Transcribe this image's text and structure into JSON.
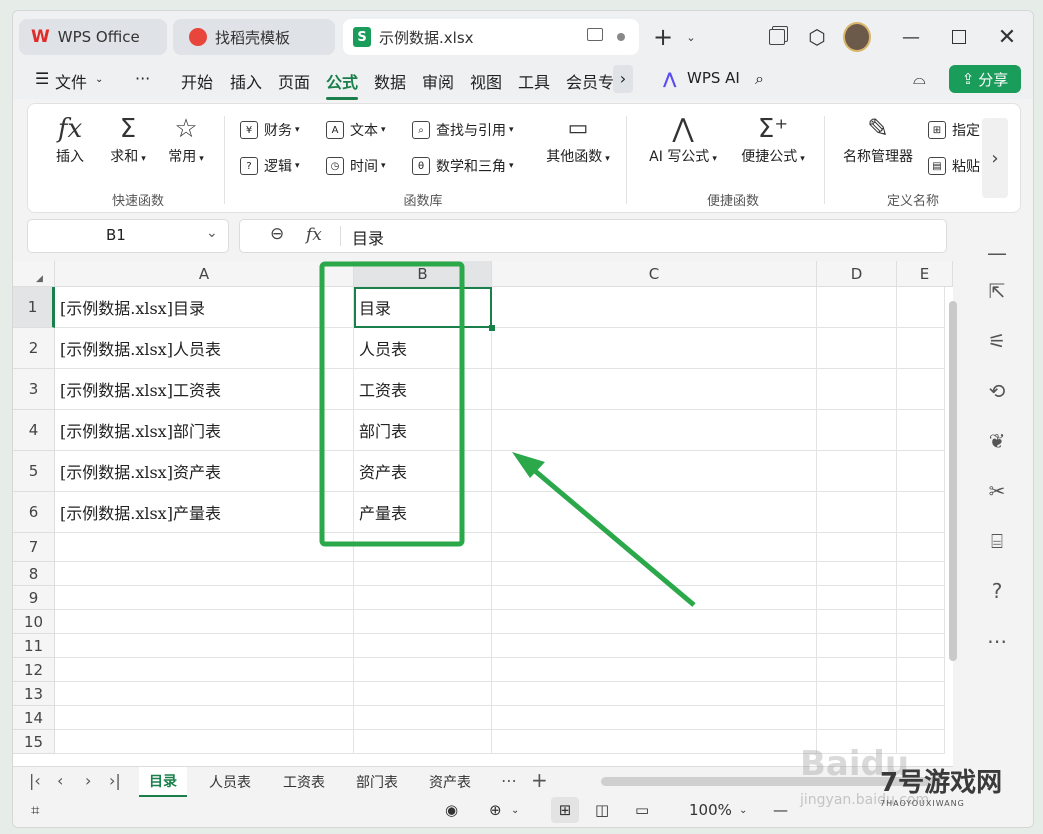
{
  "titlebar": {
    "tabs": [
      {
        "label": "WPS Office",
        "icon": "wps-logo-icon"
      },
      {
        "label": "找稻壳模板",
        "icon": "docer-icon"
      },
      {
        "label": "示例数据.xlsx",
        "icon": "sheet-file-icon"
      }
    ]
  },
  "menubar": {
    "file_label": "文件",
    "more_label": "···",
    "items": [
      "开始",
      "插入",
      "页面",
      "公式",
      "数据",
      "审阅",
      "视图",
      "工具",
      "会员专"
    ],
    "active_item": "公式",
    "ai_label": "WPS AI",
    "share_label": "分享"
  },
  "ribbon": {
    "insert_label": "插入",
    "sum_label": "求和",
    "common_label": "常用",
    "group_quick": "快速函数",
    "finance_label": "财务",
    "text_label": "文本",
    "lookup_label": "查找与引用",
    "logic_label": "逻辑",
    "time_label": "时间",
    "math_label": "数学和三角",
    "other_label": "其他函数",
    "group_library": "函数库",
    "ai_formula_label": "AI 写公式",
    "quick_formula_label": "便捷公式",
    "group_convenient": "便捷函数",
    "name_mgr_label": "名称管理器",
    "specify_label": "指定",
    "paste_label": "粘贴",
    "group_names": "定义名称"
  },
  "formula_bar": {
    "cell_ref": "B1",
    "content": "目录"
  },
  "grid": {
    "columns": [
      "A",
      "B",
      "C",
      "D",
      "E"
    ],
    "rows": [
      "1",
      "2",
      "3",
      "4",
      "5",
      "6",
      "7",
      "8",
      "9",
      "10",
      "11",
      "12",
      "13",
      "14",
      "15"
    ],
    "col_a": [
      "[示例数据.xlsx]目录",
      "[示例数据.xlsx]人员表",
      "[示例数据.xlsx]工资表",
      "[示例数据.xlsx]部门表",
      "[示例数据.xlsx]资产表",
      "[示例数据.xlsx]产量表"
    ],
    "col_b": [
      "目录",
      "人员表",
      "工资表",
      "部门表",
      "资产表",
      "产量表"
    ]
  },
  "sheet_tabs": [
    "目录",
    "人员表",
    "工资表",
    "部门表",
    "资产表"
  ],
  "status": {
    "zoom": "100%"
  },
  "watermark": {
    "baidu": "Baidu",
    "jingyan": "jingyan.baidu.com",
    "game_site": "7号游戏网",
    "game_sub": "7HAOYOUXIWANG"
  },
  "colors": {
    "accent": "#1a7f4b",
    "annotation": "#2aa84a"
  }
}
